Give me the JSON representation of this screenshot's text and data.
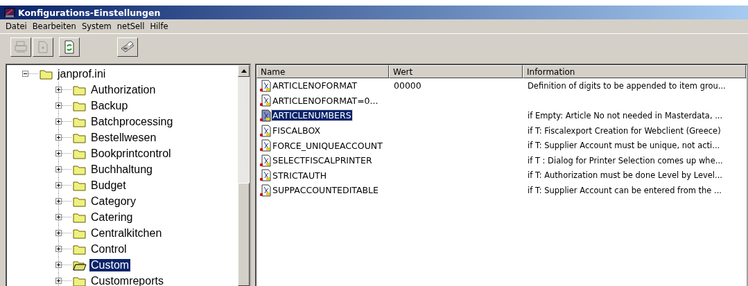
{
  "window": {
    "title": "Konfigurations-Einstellungen"
  },
  "menu": [
    "Datei",
    "Bearbeiten",
    "System",
    "netSell",
    "Hilfe"
  ],
  "toolbar": [
    {
      "kind": "print",
      "disabled": true
    },
    {
      "kind": "document",
      "disabled": true
    },
    {
      "kind": "refresh",
      "disabled": false
    },
    {
      "kind": "fax",
      "disabled": false
    }
  ],
  "tree": {
    "label": "janprof.ini",
    "expanded": true,
    "selected": false,
    "children": [
      {
        "label": "Authorization",
        "expanded": false,
        "selected": false
      },
      {
        "label": "Backup",
        "expanded": false,
        "selected": false
      },
      {
        "label": "Batchprocessing",
        "expanded": false,
        "selected": false
      },
      {
        "label": "Bestellwesen",
        "expanded": false,
        "selected": false
      },
      {
        "label": "Bookprintcontrol",
        "expanded": false,
        "selected": false
      },
      {
        "label": "Buchhaltung",
        "expanded": false,
        "selected": false
      },
      {
        "label": "Budget",
        "expanded": false,
        "selected": false
      },
      {
        "label": "Category",
        "expanded": false,
        "selected": false
      },
      {
        "label": "Catering",
        "expanded": false,
        "selected": false
      },
      {
        "label": "Centralkitchen",
        "expanded": false,
        "selected": false
      },
      {
        "label": "Control",
        "expanded": false,
        "selected": false
      },
      {
        "label": "Custom",
        "expanded": false,
        "selected": true
      },
      {
        "label": "Customreports",
        "expanded": false,
        "selected": false
      }
    ]
  },
  "list": {
    "columns": [
      "Name",
      "Wert",
      "Information"
    ],
    "rows": [
      {
        "name": "ARTICLENOFORMAT",
        "value": "00000",
        "information": "Definition of digits to be appended to item grou...",
        "selected": false
      },
      {
        "name": "ARTICLENOFORMAT=0...",
        "value": "",
        "information": "",
        "selected": false
      },
      {
        "name": "ARTICLENUMBERS",
        "value": "",
        "information": "if Empty: Article No not needed in Masterdata, ...",
        "selected": true
      },
      {
        "name": "FISCALBOX",
        "value": "",
        "information": "if T: Fiscalexport Creation for Webclient (Greece)",
        "selected": false
      },
      {
        "name": "FORCE_UNIQUEACCOUNT",
        "value": "",
        "information": "if T: Supplier Account must be unique, not acti...",
        "selected": false
      },
      {
        "name": "SELECTFISCALPRINTER",
        "value": "",
        "information": "if T : Dialog for Printer Selection comes up whe...",
        "selected": false
      },
      {
        "name": "STRICTAUTH",
        "value": "",
        "information": "if T: Authorization must be done Level by Level...",
        "selected": false
      },
      {
        "name": "SUPPACCOUNTEDITABLE",
        "value": "",
        "information": "if T: Supplier Account can be entered from the ...",
        "selected": false
      }
    ]
  }
}
